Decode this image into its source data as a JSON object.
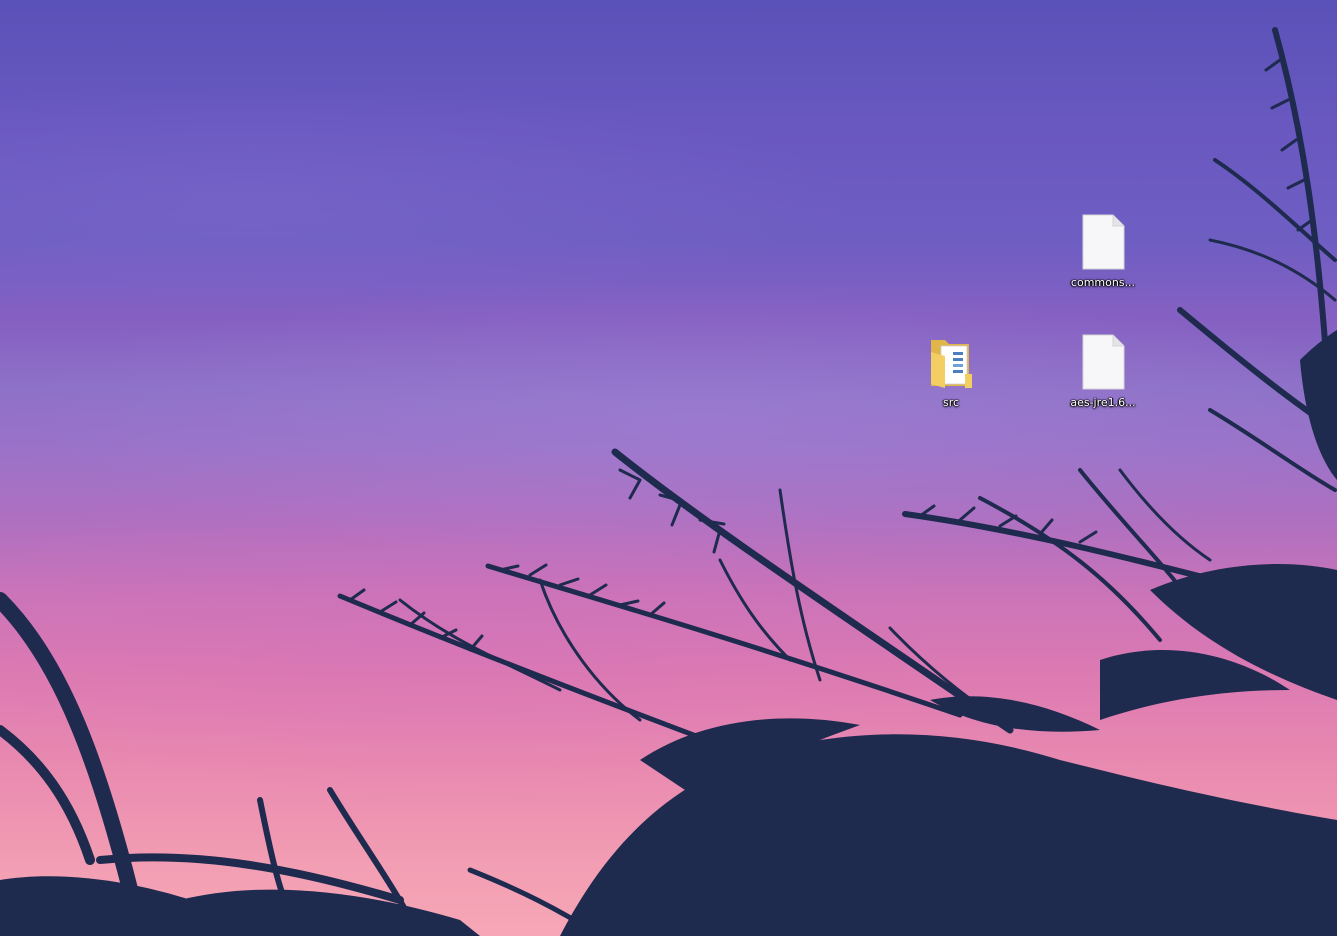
{
  "desktop": {
    "icons": [
      {
        "label": "commons...",
        "icon": "generic-file-icon"
      },
      {
        "label": "src",
        "icon": "folder-icon"
      },
      {
        "label": "aes-jre1.6...",
        "icon": "generic-file-icon"
      }
    ]
  },
  "colors": {
    "sky_top": "#5a52b8",
    "sky_mid": "#9a72c8",
    "sky_bottom": "#f6a7b6",
    "plant_silhouette": "#1e2a4e",
    "folder_yellow": "#f3cf63"
  }
}
